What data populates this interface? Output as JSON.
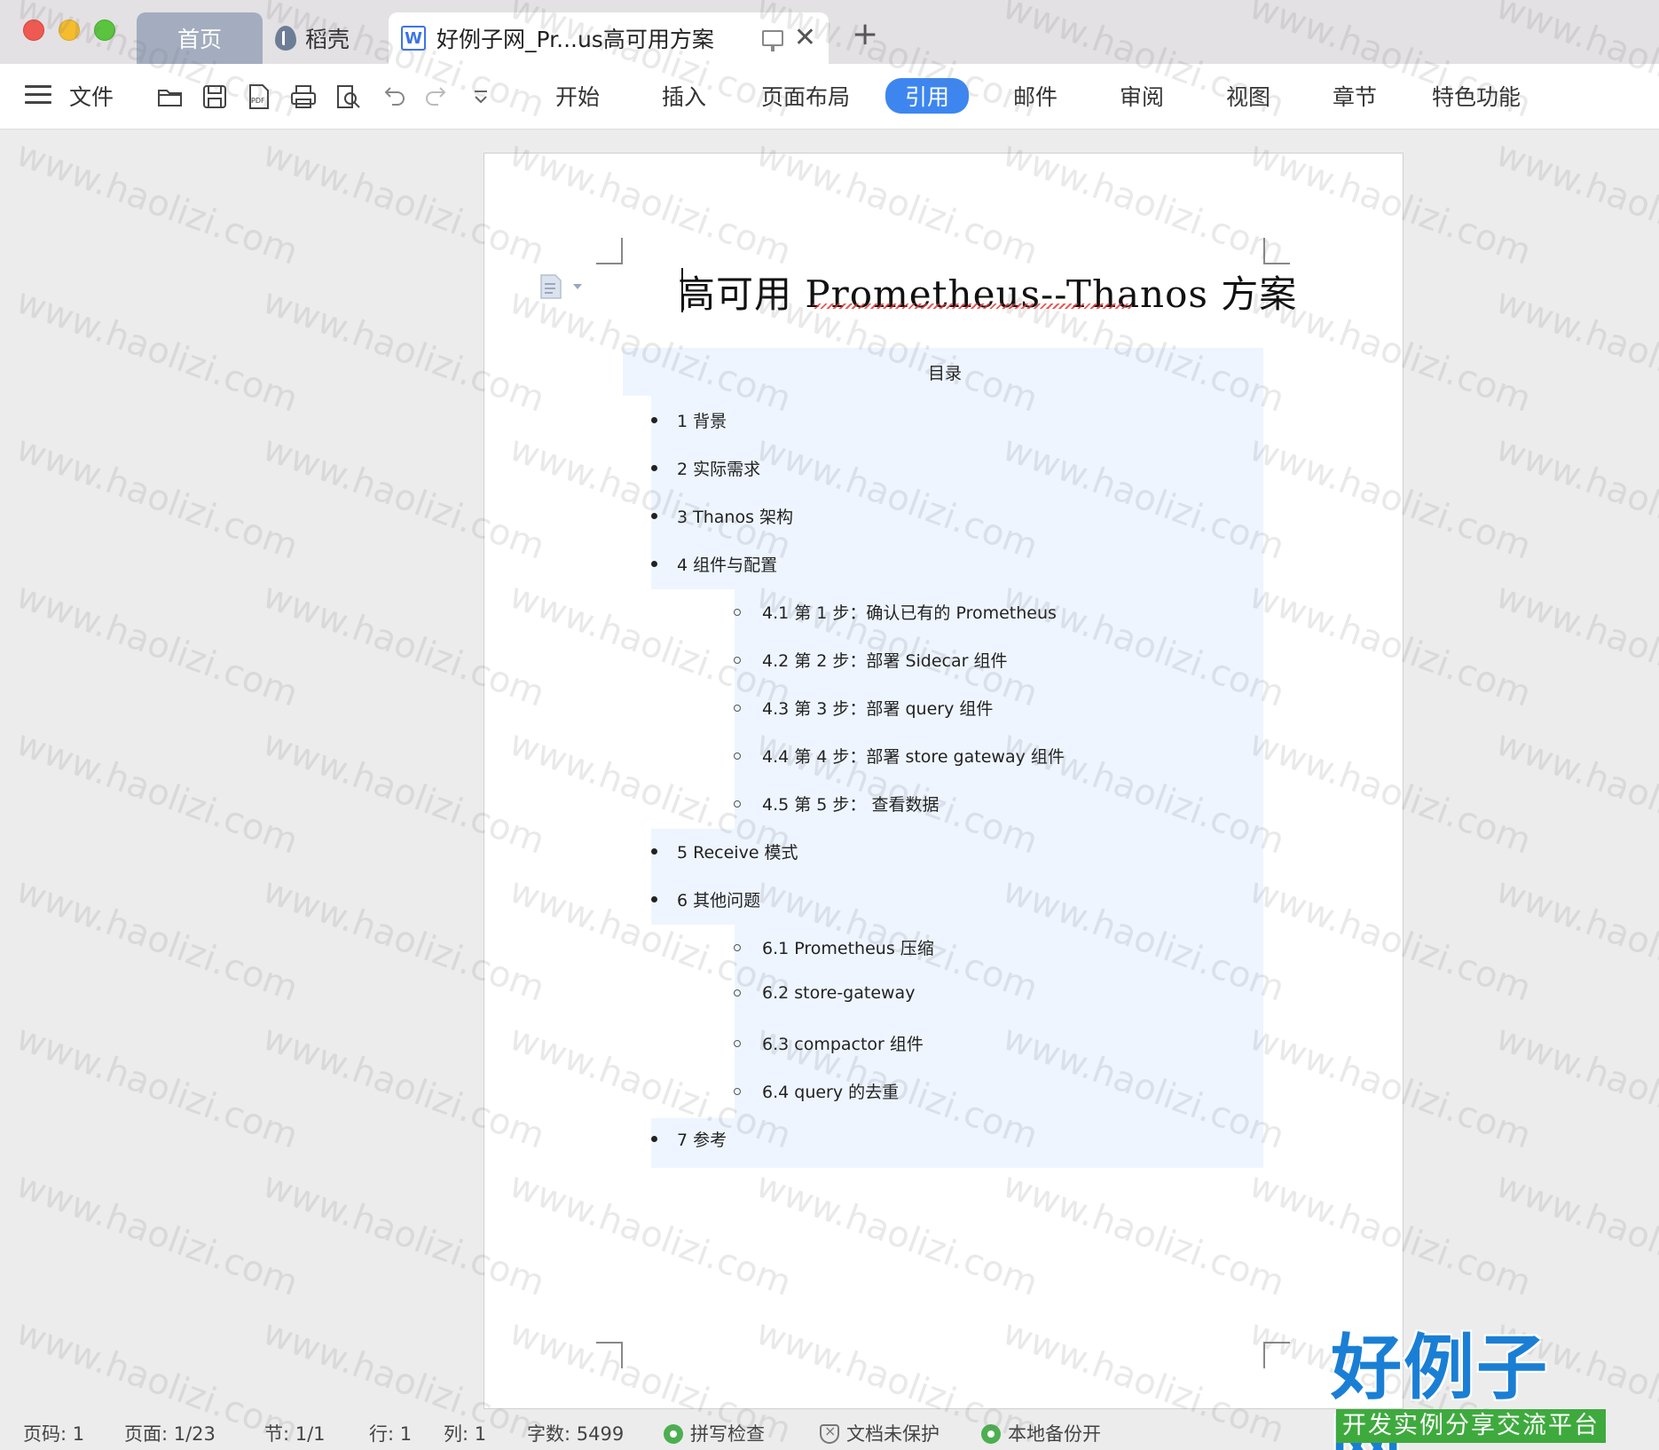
{
  "window": {
    "tabs": [
      {
        "label": "首页"
      },
      {
        "label": "稻壳"
      },
      {
        "label": "好例子网_Pr...us高可用方案"
      }
    ]
  },
  "menubar": {
    "file": "文件",
    "ribbon_tabs": [
      "开始",
      "插入",
      "页面布局",
      "引用",
      "邮件",
      "审阅",
      "视图",
      "章节",
      "特色功能"
    ],
    "active_tab": "引用"
  },
  "document": {
    "title": "高可用  Prometheus--Thanos 方案",
    "toc_heading": "目录",
    "toc": [
      {
        "level": 1,
        "text": "1 背景"
      },
      {
        "level": 1,
        "text": "2 实际需求"
      },
      {
        "level": 1,
        "text": "3 Thanos 架构"
      },
      {
        "level": 1,
        "text": "4 组件与配置"
      },
      {
        "level": 2,
        "text": "4.1 第 1 步：确认已有的 Prometheus"
      },
      {
        "level": 2,
        "text": "4.2 第 2 步：部署 Sidecar 组件"
      },
      {
        "level": 2,
        "text": "4.3 第 3 步：部署 query 组件"
      },
      {
        "level": 2,
        "text": "4.4 第 4 步：部署 store gateway 组件"
      },
      {
        "level": 2,
        "text": "4.5 第 5 步：  查看数据"
      },
      {
        "level": 1,
        "text": "5 Receive 模式"
      },
      {
        "level": 1,
        "text": "6 其他问题"
      },
      {
        "level": 2,
        "text": "6.1 Prometheus 压缩"
      },
      {
        "level": 2,
        "text": "6.2 store-gateway"
      },
      {
        "level": 2,
        "text": "6.3 compactor 组件"
      },
      {
        "level": 2,
        "text": "6.4 query 的去重"
      },
      {
        "level": 1,
        "text": "7 参考"
      }
    ]
  },
  "statusbar": {
    "page_code": "页码: 1",
    "page": "页面: 1/23",
    "section": "节: 1/1",
    "row": "行: 1",
    "col": "列: 1",
    "word_count": "字数: 5499",
    "spell_check": "拼写检查",
    "doc_protect": "文档未保护",
    "backup": "本地备份开"
  },
  "watermark": {
    "text": "www.haolizi.com",
    "logo_main": "好例子网",
    "logo_sub": "开发实例分享交流平台"
  },
  "colors": {
    "accent": "#3d86f0",
    "toc_bg": "#eef5ff",
    "logo_blue": "#1a7fd4",
    "logo_green": "#3eaa3e"
  }
}
